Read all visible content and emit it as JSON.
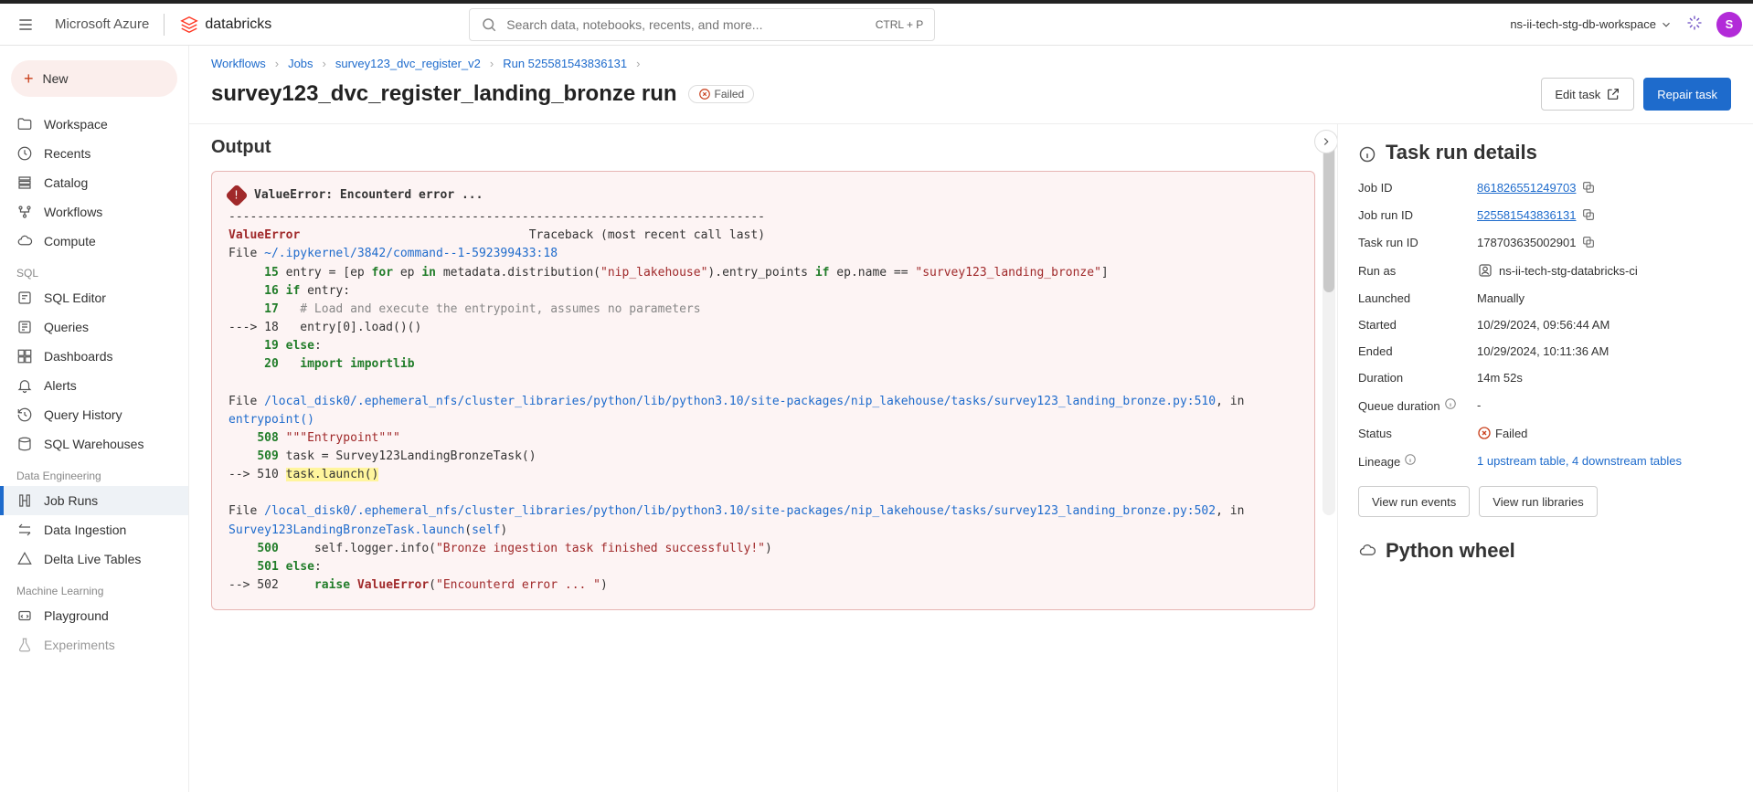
{
  "topbar": {
    "product": "Microsoft Azure",
    "brand": "databricks",
    "search_placeholder": "Search data, notebooks, recents, and more...",
    "search_shortcut": "CTRL + P",
    "workspace": "ns-ii-tech-stg-db-workspace",
    "avatar_letter": "S"
  },
  "sidebar": {
    "new_label": "New",
    "core": [
      {
        "label": "Workspace",
        "name": "workspace"
      },
      {
        "label": "Recents",
        "name": "recents"
      },
      {
        "label": "Catalog",
        "name": "catalog"
      },
      {
        "label": "Workflows",
        "name": "workflows"
      },
      {
        "label": "Compute",
        "name": "compute"
      }
    ],
    "sql_label": "SQL",
    "sql": [
      {
        "label": "SQL Editor",
        "name": "sql-editor"
      },
      {
        "label": "Queries",
        "name": "queries"
      },
      {
        "label": "Dashboards",
        "name": "dashboards"
      },
      {
        "label": "Alerts",
        "name": "alerts"
      },
      {
        "label": "Query History",
        "name": "query-history"
      },
      {
        "label": "SQL Warehouses",
        "name": "sql-warehouses"
      }
    ],
    "de_label": "Data Engineering",
    "de": [
      {
        "label": "Job Runs",
        "name": "job-runs",
        "active": true
      },
      {
        "label": "Data Ingestion",
        "name": "data-ingestion"
      },
      {
        "label": "Delta Live Tables",
        "name": "delta-live-tables"
      }
    ],
    "ml_label": "Machine Learning",
    "ml": [
      {
        "label": "Playground",
        "name": "playground"
      },
      {
        "label": "Experiments",
        "name": "experiments"
      }
    ]
  },
  "breadcrumb": {
    "items": [
      "Workflows",
      "Jobs",
      "survey123_dvc_register_v2",
      "Run 525581543836131"
    ]
  },
  "page": {
    "title": "survey123_dvc_register_landing_bronze run",
    "status": "Failed",
    "edit_label": "Edit task",
    "repair_label": "Repair task",
    "output_heading": "Output"
  },
  "error": {
    "summary": "ValueError: Encounterd error ...",
    "traceback_header": "Traceback (most recent call last)",
    "name": "ValueError",
    "file1": "~/.ipykernel/3842/command--1-592399433:18",
    "file2": "/local_disk0/.ephemeral_nfs/cluster_libraries/python/lib/python3.10/site-packages/nip_lakehouse/tasks/survey123_landing_bronze.py:510",
    "file2_loc": "entrypoint()",
    "file3": "/local_disk0/.ephemeral_nfs/cluster_libraries/python/lib/python3.10/site-packages/nip_lakehouse/tasks/survey123_landing_bronze.py:502",
    "file3_loc": "Survey123LandingBronzeTask.launch"
  },
  "details": {
    "heading": "Task run details",
    "job_id_label": "Job ID",
    "job_id": "861826551249703",
    "job_run_id_label": "Job run ID",
    "job_run_id": "525581543836131",
    "task_run_id_label": "Task run ID",
    "task_run_id": "178703635002901",
    "run_as_label": "Run as",
    "run_as": "ns-ii-tech-stg-databricks-ci",
    "launched_label": "Launched",
    "launched": "Manually",
    "started_label": "Started",
    "started": "10/29/2024, 09:56:44 AM",
    "ended_label": "Ended",
    "ended": "10/29/2024, 10:11:36 AM",
    "duration_label": "Duration",
    "duration": "14m 52s",
    "queue_label": "Queue duration",
    "queue": "-",
    "status_label": "Status",
    "status": "Failed",
    "lineage_label": "Lineage",
    "lineage": "1 upstream table, 4 downstream tables",
    "view_events": "View run events",
    "view_libs": "View run libraries",
    "wheel_heading": "Python wheel"
  }
}
